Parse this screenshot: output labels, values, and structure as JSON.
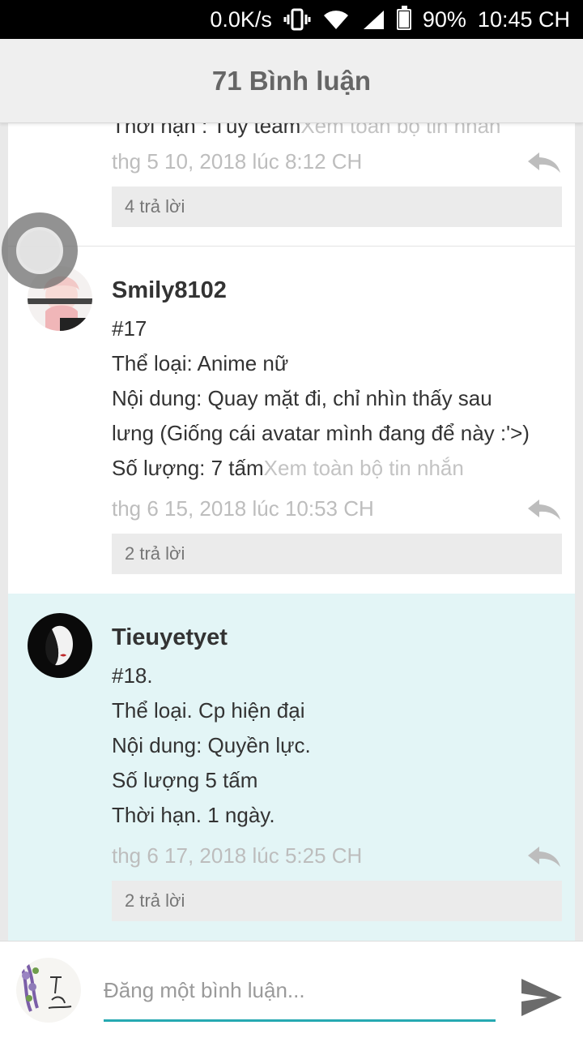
{
  "status_bar": {
    "network_speed": "0.0K/s",
    "battery_percent": "90%",
    "battery_level": 0.9,
    "time": "10:45 CH",
    "icons": [
      "vibrate-icon",
      "wifi-icon",
      "signal-icon",
      "battery-icon"
    ]
  },
  "header": {
    "title": "71 Bình luận"
  },
  "comments": [
    {
      "username": "",
      "lines": [],
      "partial_line": "Thời hạn : Tùy team",
      "see_more": "Xem toàn bộ tin nhắn",
      "timestamp": "thg 5 10, 2018 lúc 8:12 CH",
      "replies": "4 trả lời"
    },
    {
      "username": "Smily8102",
      "lines": [
        "#17",
        "Thể loại: Anime nữ",
        "Nội dung: Quay mặt đi, chỉ nhìn thấy sau",
        "lưng (Giống cái avatar mình đang để này :'>)",
        "Số lượng: 7 tấm"
      ],
      "see_more": "Xem toàn bộ tin nhắn",
      "timestamp": "thg 6 15, 2018 lúc 10:53 CH",
      "replies": "2 trả lời"
    },
    {
      "username": "Tieuyetyet",
      "lines": [
        "#18.",
        "Thể loại. Cp hiện đại",
        "Nội dung: Quyền lực.",
        "Số lượng 5 tấm",
        "Thời hạn. 1 ngày."
      ],
      "timestamp": "thg 6 17, 2018 lúc 5:25 CH",
      "replies": "2 trả lời",
      "highlight_color": "#e3f5f6"
    }
  ],
  "composer": {
    "placeholder": "Đăng một bình luận..."
  },
  "colors": {
    "accent": "#26a9b2",
    "highlight": "#e3f5f6",
    "muted_text": "#bdbdbd"
  }
}
